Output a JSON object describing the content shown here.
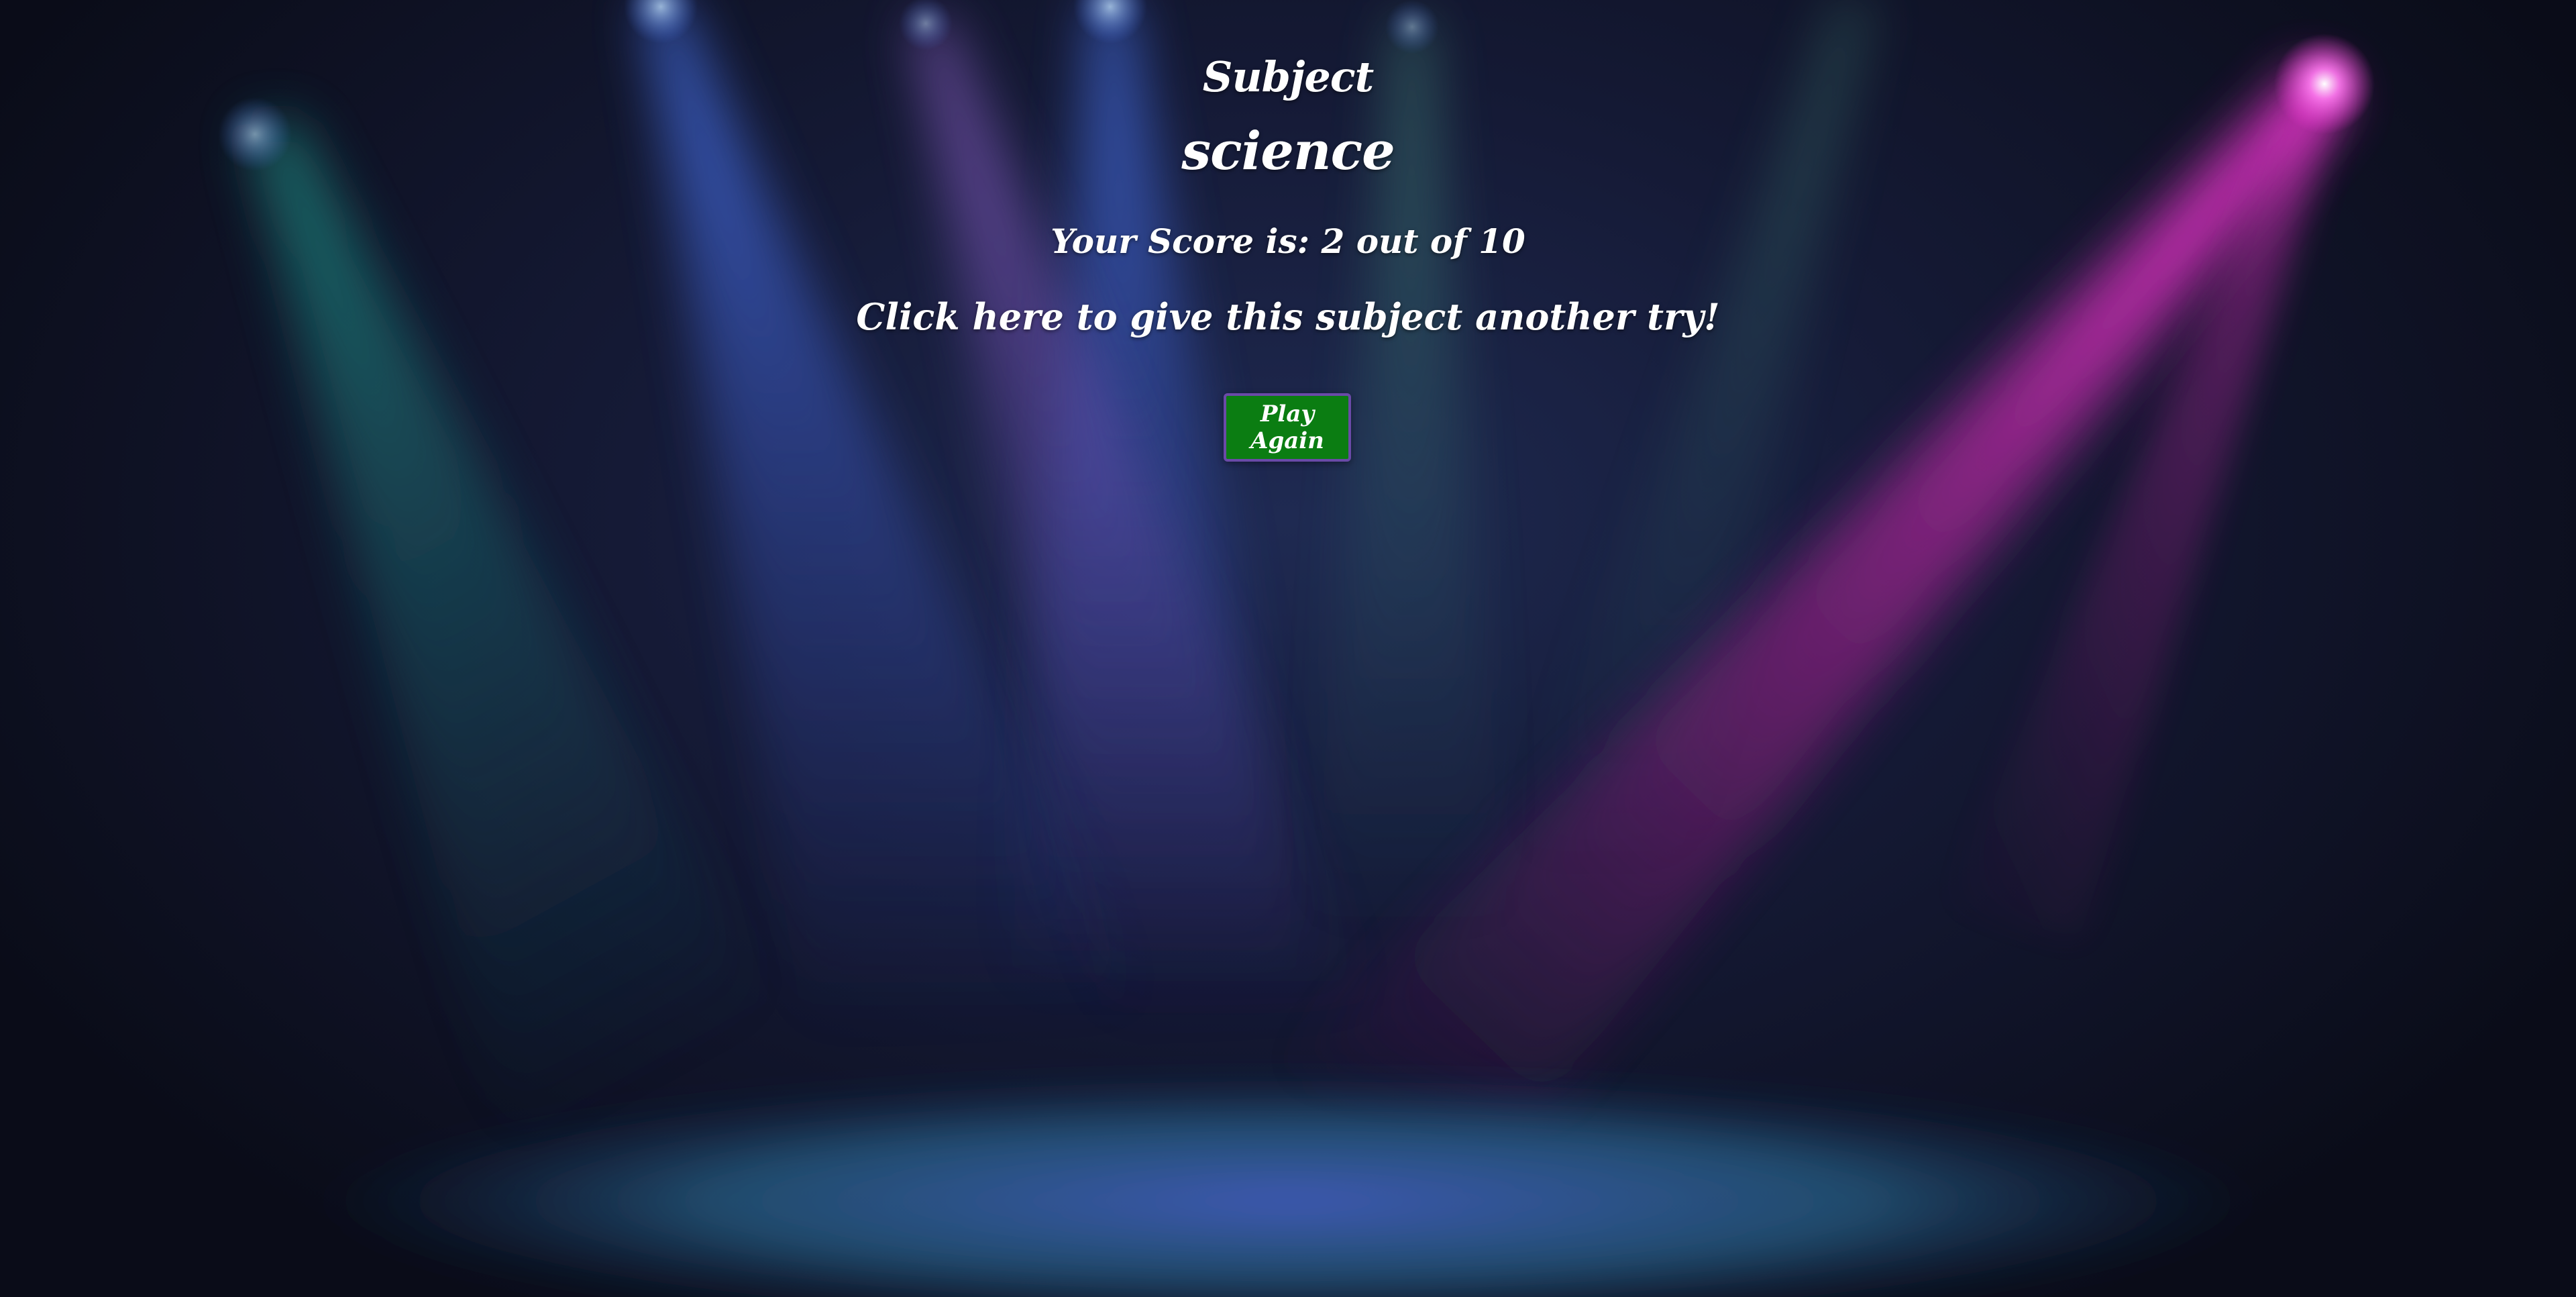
{
  "result": {
    "title_label": "Subject",
    "subject_name": "science",
    "score_text": "Your Score is: 2 out of 10",
    "retry_prompt": "Click here to give this subject another try!",
    "play_again_label": "Play Again"
  },
  "colors": {
    "button_bg": "#0b7d12",
    "button_border": "#6a4aa8",
    "text": "#ffffff",
    "background": "#0b0d1c"
  }
}
